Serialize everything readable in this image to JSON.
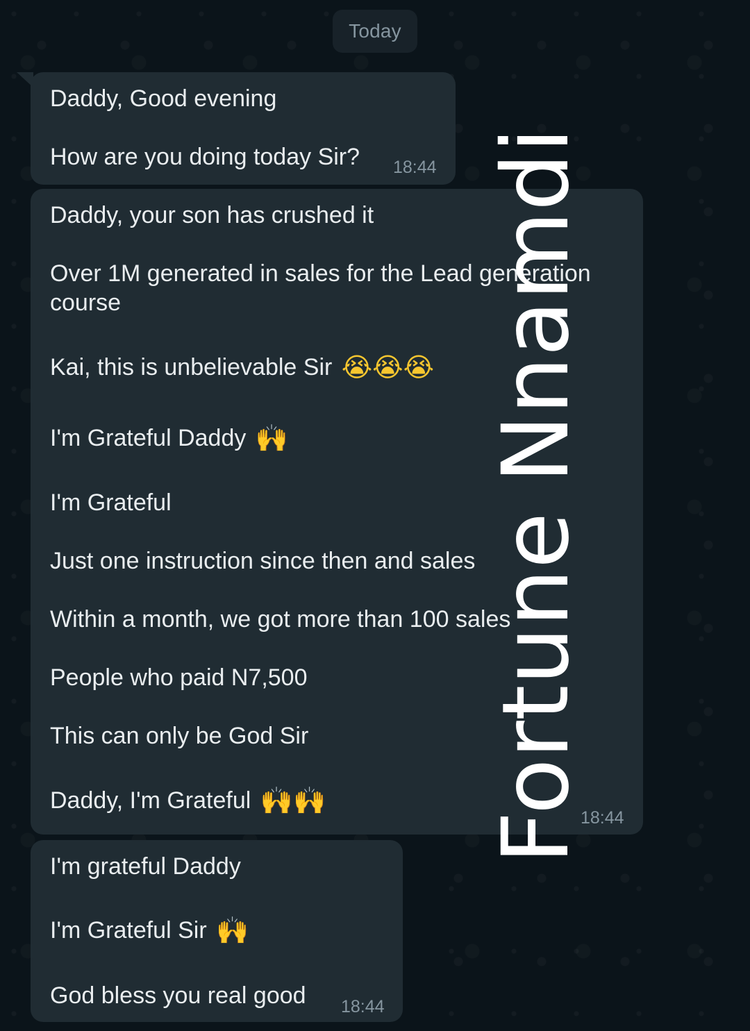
{
  "date_chip": "Today",
  "messages": [
    {
      "lines": [
        "Daddy, Good evening",
        "How are you doing today Sir?"
      ],
      "time": "18:44"
    },
    {
      "lines": [
        "Daddy, your son has crushed it",
        "Over 1M generated in sales for the Lead generation",
        "course",
        "Kai, this is unbelievable Sir",
        "I'm Grateful Daddy",
        "I'm Grateful",
        "Just one instruction since then and sales",
        "Within a month, we got more than 100 sales",
        "People who paid N7,500",
        "This can only be God Sir",
        "Daddy, I'm Grateful"
      ],
      "time": "18:44"
    },
    {
      "lines": [
        "I'm grateful Daddy",
        "I'm Grateful Sir",
        "God bless you real good"
      ],
      "time": "18:44"
    }
  ],
  "emojis": {
    "crying": "😭😭😭",
    "raised_hands_single": "🙌",
    "raised_hands_double": "🙌🙌"
  },
  "watermark": "Fortune Nnamdi",
  "colors": {
    "background": "#0b141a",
    "bubble": "#202c33",
    "text": "#e9edef",
    "meta": "#8696a0"
  }
}
